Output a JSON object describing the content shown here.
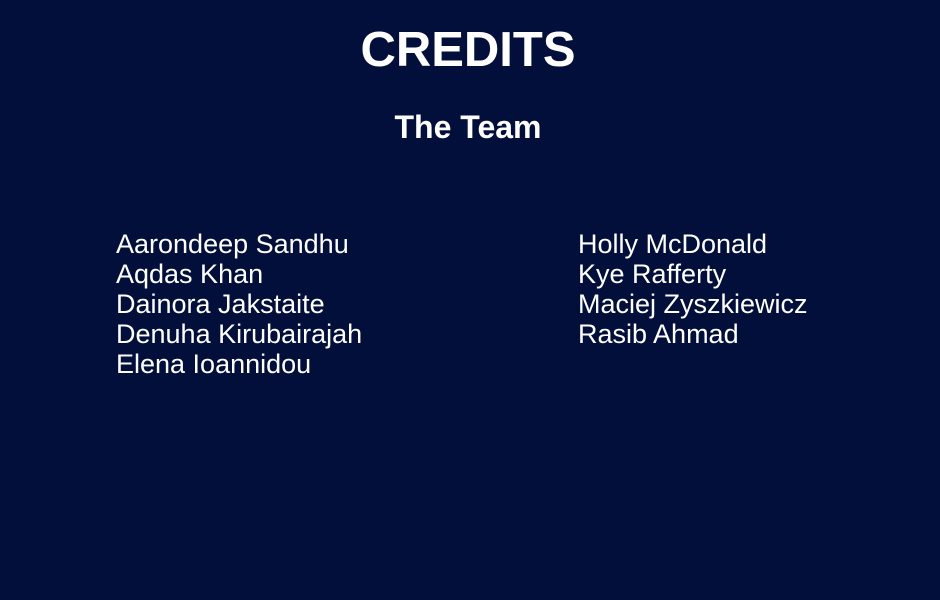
{
  "title": "CREDITS",
  "subtitle": "The Team",
  "team": {
    "column1": [
      "Aarondeep Sandhu",
      "Aqdas Khan",
      "Dainora Jakstaite",
      "Denuha Kirubairajah",
      "Elena Ioannidou"
    ],
    "column2": [
      "Holly McDonald",
      "Kye Rafferty",
      "Maciej Zyszkiewicz",
      "Rasib Ahmad"
    ]
  },
  "colors": {
    "background": "#020f3b",
    "text": "#ffffff"
  }
}
